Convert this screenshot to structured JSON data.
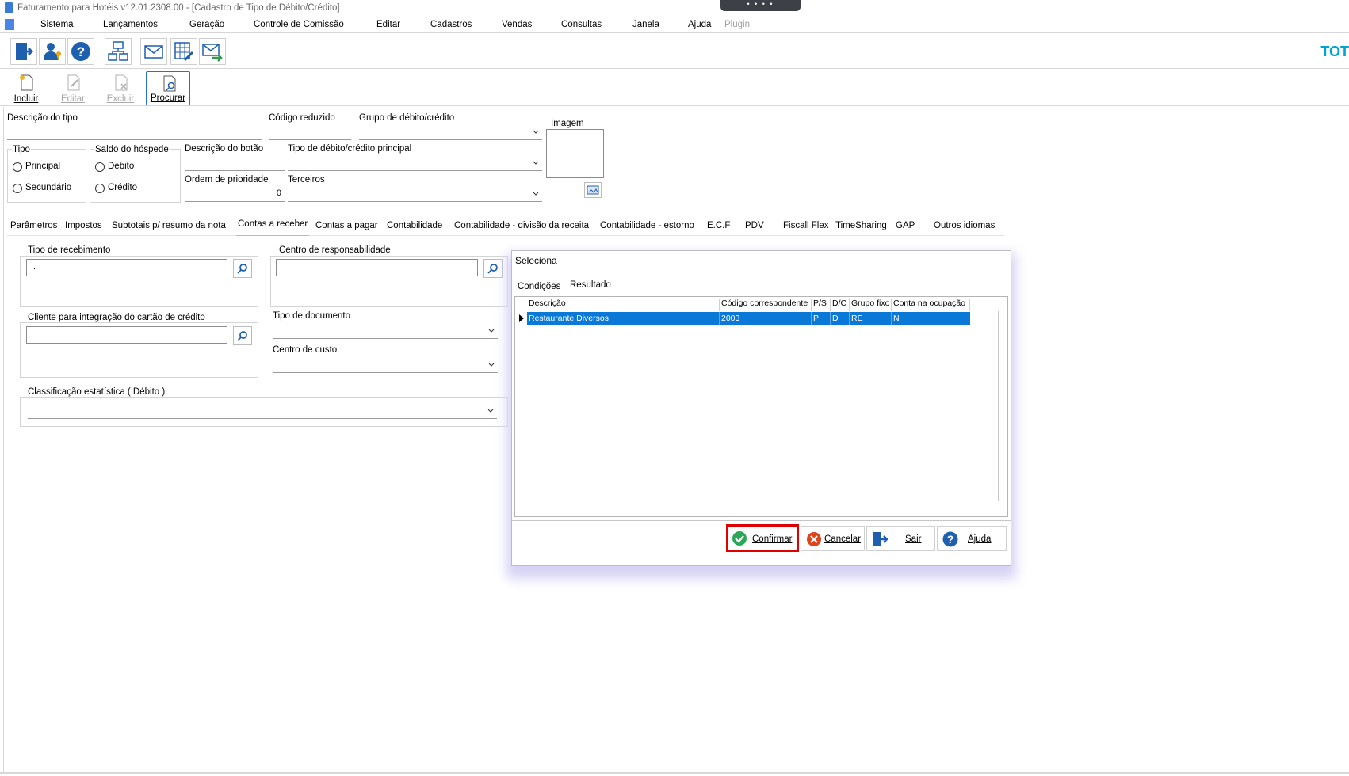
{
  "window": {
    "title": "Faturamento para Hotéis v12.01.2308.00 - [Cadastro de Tipo de Débito/Crédito]",
    "handle_dots": "• • • •",
    "brand": "TOT"
  },
  "menu": {
    "items": [
      "Sistema",
      "Lançamentos",
      "Geração",
      "Controle de Comissão",
      "Editar",
      "Cadastros",
      "Vendas",
      "Consultas",
      "Janela",
      "Ajuda"
    ],
    "disabled_item": "Plugin"
  },
  "actions": {
    "incluir": "Incluir",
    "editar": "Editar",
    "excluir": "Excluir",
    "procurar": "Procurar"
  },
  "form": {
    "descricao_tipo_label": "Descrição do tipo",
    "codigo_reduzido_label": "Código reduzido",
    "grupo_label": "Grupo de débito/crédito",
    "imagem_label": "Imagem",
    "tipo_label": "Tipo",
    "tipo_principal": "Principal",
    "tipo_secundario": "Secundário",
    "saldo_label": "Saldo do hóspede",
    "saldo_debito": "Débito",
    "saldo_credito": "Crédito",
    "descricao_botao_label": "Descrição do botão",
    "tipo_principal_label": "Tipo de débito/crédito principal",
    "ordem_label": "Ordem de prioridade",
    "ordem_value": "0",
    "terceiros_label": "Terceiros"
  },
  "tabs": [
    "Parâmetros",
    "Impostos",
    "Subtotais p/ resumo da nota",
    "Contas a receber",
    "Contas a pagar",
    "Contabilidade",
    "Contabilidade - divisão da receita",
    "Contabilidade - estorno",
    "E.C.F",
    "PDV",
    "Fiscall Flex",
    "TimeSharing",
    "GAP",
    "Outros idiomas"
  ],
  "contas_receber": {
    "tipo_recebimento_label": "Tipo de recebimento",
    "tipo_recebimento_value": ".",
    "centro_resp_label": "Centro de responsabilidade",
    "cliente_label": "Cliente para integração do cartão de crédito",
    "tipo_documento_label": "Tipo de documento",
    "centro_custo_label": "Centro de custo",
    "classificacao_label": "Classificação estatística ( Débito )"
  },
  "dialog": {
    "title": "Seleciona",
    "tab_condicoes": "Condições",
    "tab_resultado": "Resultado",
    "columns": [
      "Descrição",
      "Código correspondente",
      "P/S",
      "D/C",
      "Grupo fixo",
      "Conta na ocupação"
    ],
    "rows": [
      [
        "Restaurante  Diversos",
        "2003",
        "P",
        "D",
        "RE",
        "N"
      ]
    ],
    "buttons": {
      "confirmar": "Confirmar",
      "cancelar": "Cancelar",
      "sair": "Sair",
      "ajuda": "Ajuda"
    }
  },
  "colors": {
    "selection": "#0a78d7",
    "highlight": "#e00000",
    "brand": "#00a4d3"
  }
}
